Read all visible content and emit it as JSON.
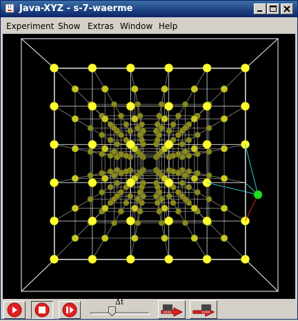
{
  "window": {
    "title": "Java-XYZ - s-7-waerme"
  },
  "menu": [
    {
      "label": "Experiment"
    },
    {
      "label": "Show"
    },
    {
      "label": "Extras"
    },
    {
      "label": "Window"
    },
    {
      "label": "Help"
    }
  ],
  "toolbar": {
    "timestep_label": "Δt",
    "timestep_value": 0.35
  },
  "colors": {
    "background": "#000000",
    "atom": "#ffff33",
    "atom_back": "#8a8a1e",
    "bond": "#ffffff",
    "highlight_atom": "#22dd22",
    "cyan_bond": "#33cccc",
    "red_bond": "#dd2222"
  },
  "icons": [
    "java-cup-icon",
    "minimize-icon",
    "maximize-icon",
    "close-icon",
    "play-icon",
    "stop-icon",
    "pause-icon",
    "save-icon",
    "load-icon"
  ]
}
